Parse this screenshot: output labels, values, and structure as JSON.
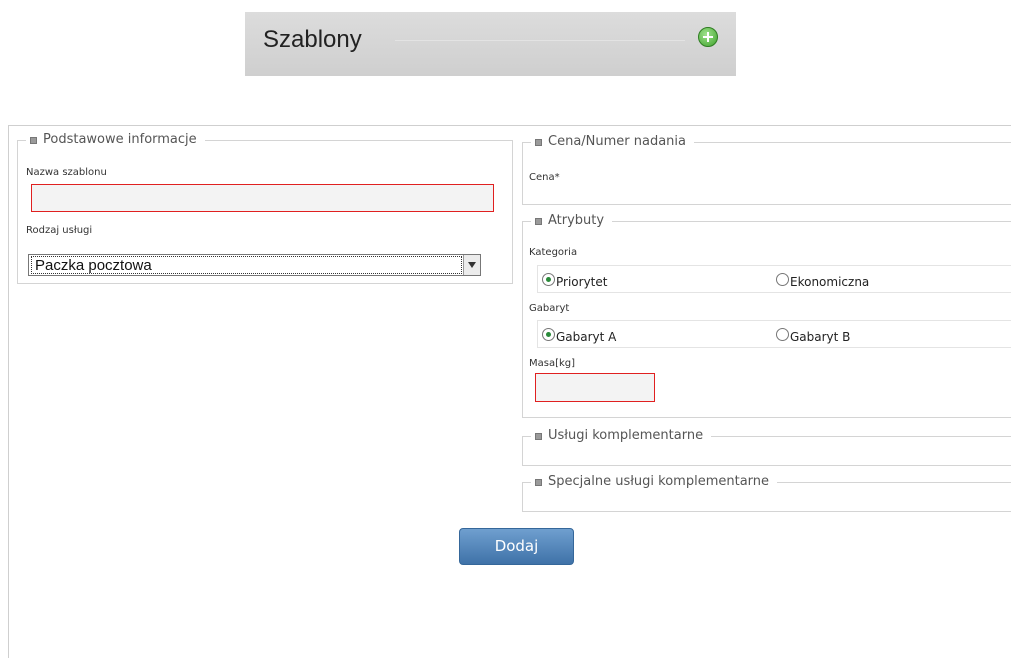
{
  "header": {
    "title": "Szablony",
    "add_icon": "plus-circle-icon"
  },
  "basic": {
    "legend": "Podstawowe informacje",
    "template_name_label": "Nazwa szablonu",
    "template_name_value": "",
    "service_label": "Rodzaj usługi",
    "service_selected": "Paczka pocztowa"
  },
  "price": {
    "legend": "Cena/Numer nadania",
    "price_label": "Cena*"
  },
  "attributes": {
    "legend": "Atrybuty",
    "category_label": "Kategoria",
    "category_options": [
      "Priorytet",
      "Ekonomiczna"
    ],
    "category_selected": "Priorytet",
    "size_label": "Gabaryt",
    "size_options": [
      "Gabaryt A",
      "Gabaryt B"
    ],
    "size_selected": "Gabaryt A",
    "mass_label": "Masa[kg]",
    "mass_value": ""
  },
  "complementary": {
    "legend": "Usługi komplementarne"
  },
  "special_complementary": {
    "legend": "Specjalne usługi komplementarne"
  },
  "actions": {
    "submit_label": "Dodaj"
  },
  "colors": {
    "error_border": "#e02020",
    "button": "#4a7db3",
    "selected_radio": "#2a8a3a"
  }
}
